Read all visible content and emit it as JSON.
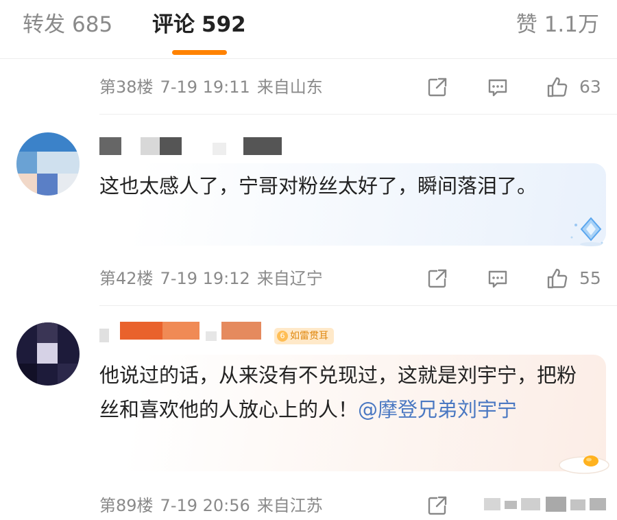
{
  "tabs": {
    "forward": {
      "label": "转发",
      "count": "685"
    },
    "comments": {
      "label": "评论",
      "count": "592"
    },
    "likes": {
      "label": "赞",
      "count": "1.1万"
    }
  },
  "colors": {
    "accent": "#ff8200",
    "mention": "#4a78c2",
    "meta": "#8a8a8a",
    "badge_text": "#e08a13",
    "badge_bg": "#ffe9c9"
  },
  "comments": [
    {
      "floor": "第38楼",
      "time": "7-19 19:11",
      "location": "来自山东",
      "likes": "63"
    },
    {
      "text": "这也太感人了，宁哥对粉丝太好了，瞬间落泪了。",
      "floor": "第42楼",
      "time": "7-19 19:12",
      "location": "来自辽宁",
      "likes": "55"
    },
    {
      "badge": "如雷贯耳",
      "text": "他说过的话，从来没有不兑现过，这就是刘宇宁，把粉丝和喜欢他的人放心上的人！",
      "mention": "@摩登兄弟刘宇宁",
      "floor": "第89楼",
      "time": "7-19 20:56",
      "location": "来自江苏"
    }
  ],
  "icons": {
    "forward": "forward-icon",
    "reply": "comment-icon",
    "like": "thumbs-up-icon",
    "sparkle": "diamond-sparkle-icon",
    "egg": "fried-egg-icon"
  }
}
